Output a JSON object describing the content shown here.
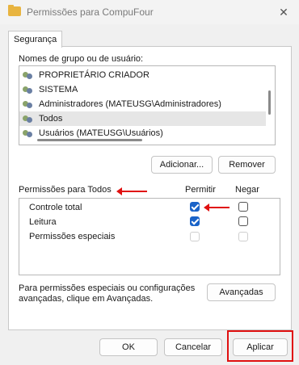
{
  "window": {
    "title": "Permissões para CompuFour",
    "close_glyph": "✕"
  },
  "tabs": [
    {
      "label": "Segurança"
    }
  ],
  "users_section": {
    "label": "Nomes de grupo ou de usuário:",
    "items": [
      {
        "label": "PROPRIETÁRIO CRIADOR",
        "selected": false
      },
      {
        "label": "SISTEMA",
        "selected": false
      },
      {
        "label": "Administradores (MATEUSG\\Administradores)",
        "selected": false
      },
      {
        "label": "Todos",
        "selected": true
      },
      {
        "label": "Usuários (MATEUSG\\Usuários)",
        "selected": false
      }
    ],
    "add_button": "Adicionar...",
    "remove_button": "Remover"
  },
  "permissions": {
    "label": "Permissões para Todos",
    "allow_header": "Permitir",
    "deny_header": "Negar",
    "rows": [
      {
        "label": "Controle total",
        "allow": true,
        "deny": false,
        "enabled": true
      },
      {
        "label": "Leitura",
        "allow": true,
        "deny": false,
        "enabled": true
      },
      {
        "label": "Permissões especiais",
        "allow": false,
        "deny": false,
        "enabled": false
      }
    ]
  },
  "advanced": {
    "text_line1": "Para permissões especiais ou configurações",
    "text_line2": "avançadas, clique em Avançadas.",
    "button": "Avançadas"
  },
  "footer": {
    "ok": "OK",
    "cancel": "Cancelar",
    "apply": "Aplicar"
  },
  "colors": {
    "accent": "#1a63c8",
    "annotation": "#e01010"
  },
  "icons": {
    "folder": "folder-icon",
    "user_group": "user-group-icon"
  }
}
